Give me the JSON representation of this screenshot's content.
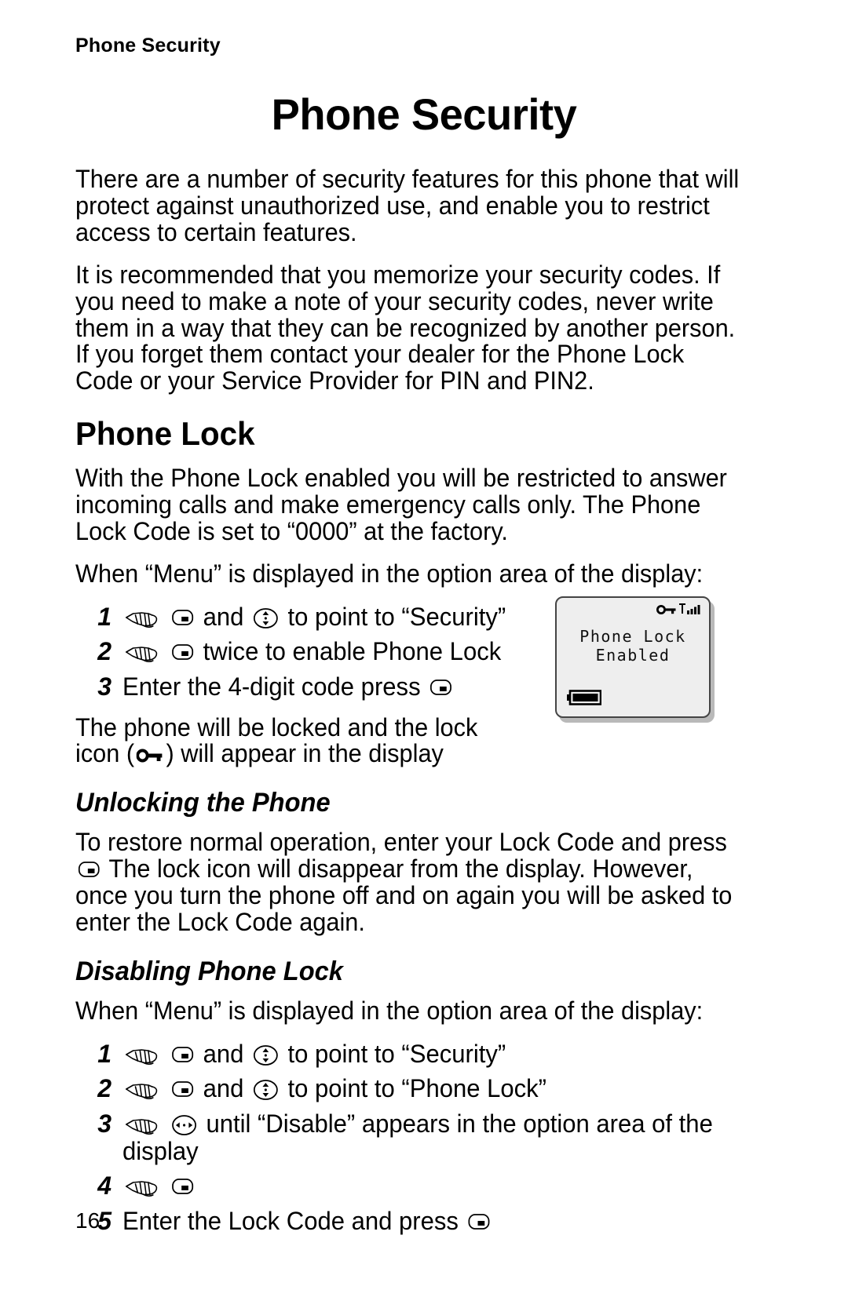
{
  "document": {
    "running_head": "Phone Security",
    "chapter_title": "Phone Security",
    "page_number": "16"
  },
  "intro": {
    "paragraph_1": "There are a number of security features for this phone that will protect against unauthorized use, and enable you to restrict access to certain features.",
    "paragraph_2": "It is recommended that you memorize your security codes. If you need to make a note of your security codes, never write them in a way that they can be recognized by another person. If you forget them contact your dealer for the Phone Lock Code or your Service Provider for PIN and PIN2."
  },
  "phone_lock": {
    "heading": "Phone Lock",
    "paragraph": "With the Phone Lock enabled you will be restricted to answer incoming calls and make emergency calls only. The Phone Lock Code is set to “0000” at the factory.",
    "lead_in": "When “Menu” is displayed in the option area of the display:",
    "steps": [
      {
        "num": "1",
        "icons": [
          "hand-icon",
          "softkey-icon"
        ],
        "text_a": "",
        "text_b": "and",
        "icon_b": "navkey-vertical-icon",
        "text_c": "to point to “Security”"
      },
      {
        "num": "2",
        "icons": [
          "hand-icon",
          "softkey-icon"
        ],
        "text_a": "",
        "text_b": "twice to enable Phone Lock",
        "icon_b": "",
        "text_c": ""
      },
      {
        "num": "3",
        "icons": [],
        "text_a": "Enter the 4-digit code press",
        "text_b": "",
        "icon_b": "softkey-icon",
        "text_c": ""
      }
    ],
    "closing_before": "The phone will be locked and the lock icon (",
    "closing_after": ") will appear in the display"
  },
  "unlocking": {
    "heading": "Unlocking the Phone",
    "paragraph_before": "To restore normal operation, enter your Lock Code and press",
    "paragraph_after": "The lock icon will disappear from the display. However, once you turn the phone off and on again you will be asked to enter the Lock Code again."
  },
  "disabling": {
    "heading": "Disabling Phone Lock",
    "lead_in": "When “Menu” is displayed in the option area of the display:",
    "steps": [
      {
        "num": "1",
        "mid": "and",
        "tail": "to point to “Security”"
      },
      {
        "num": "2",
        "mid": "and",
        "tail": "to point to “Phone Lock”"
      },
      {
        "num": "3",
        "mid": "",
        "tail": "until “Disable” appears in the option area of the display"
      },
      {
        "num": "4",
        "mid": "",
        "tail": ""
      },
      {
        "num": "5",
        "mid": "",
        "tail": "Enter the Lock Code and press"
      }
    ]
  },
  "phone_screen": {
    "status_icons": [
      "lock-icon",
      "signal-strength-icon"
    ],
    "line_1": "Phone Lock",
    "line_2": "Enabled",
    "battery_icon": "battery-full-icon"
  },
  "colors": {
    "page_background": "#ffffff",
    "text": "#000000",
    "display_background": "#eeeeee",
    "display_border": "#444444",
    "display_shadow": "#b9b9b9"
  }
}
